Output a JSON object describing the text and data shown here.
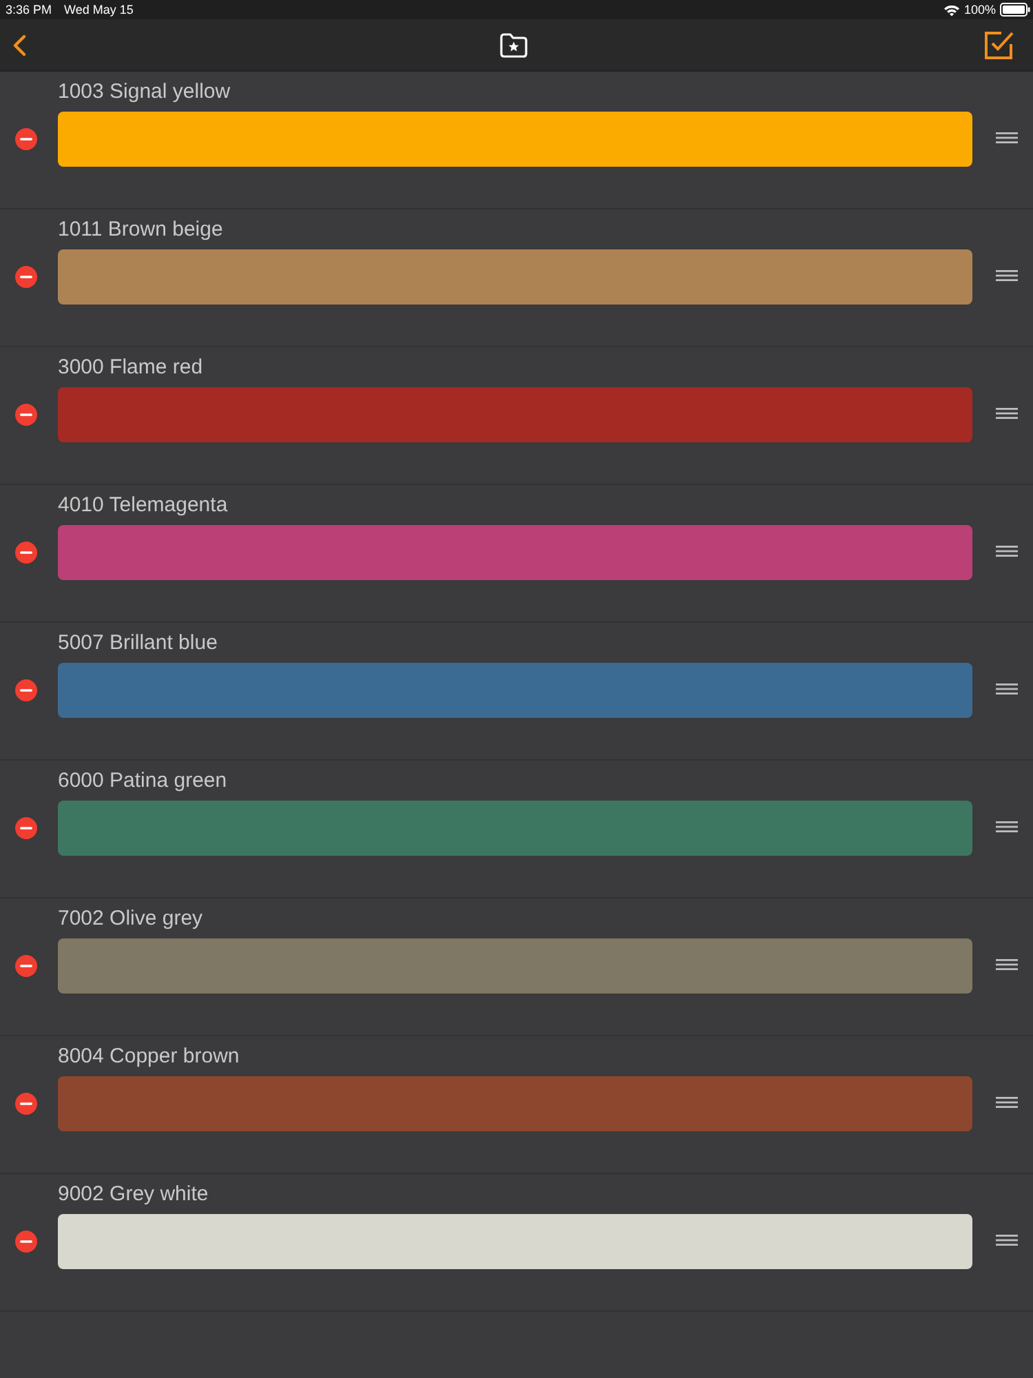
{
  "status_bar": {
    "time": "3:36 PM",
    "date": "Wed May 15",
    "battery": "100%"
  },
  "colors": [
    {
      "name": "1003 Signal yellow",
      "color": "#fbab00"
    },
    {
      "name": "1011 Brown beige",
      "color": "#ad8354"
    },
    {
      "name": "3000 Flame red",
      "color": "#a62a24"
    },
    {
      "name": "4010 Telemagenta",
      "color": "#bb4076"
    },
    {
      "name": "5007 Brillant blue",
      "color": "#3b6b93"
    },
    {
      "name": "6000 Patina green",
      "color": "#3d7661"
    },
    {
      "name": "7002 Olive grey",
      "color": "#7e7864"
    },
    {
      "name": "8004 Copper brown",
      "color": "#8c472e"
    },
    {
      "name": "9002 Grey white",
      "color": "#d8d8cf"
    }
  ]
}
